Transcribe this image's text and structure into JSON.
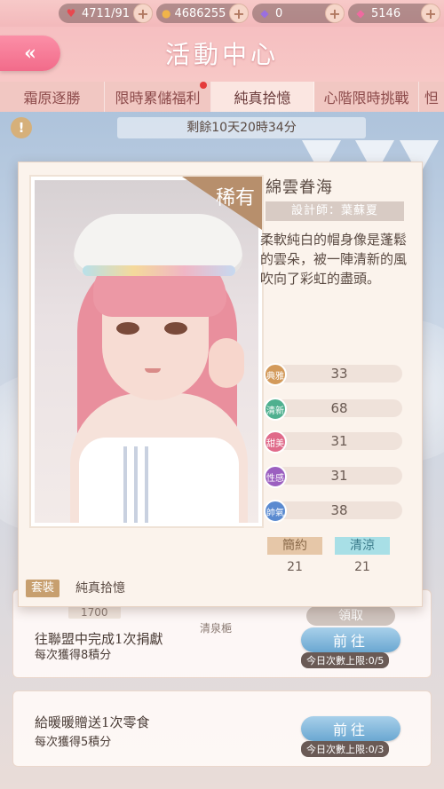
{
  "resources": [
    {
      "icon": "heart-icon",
      "value": "4711/91",
      "color": "#e8484f"
    },
    {
      "icon": "coin-icon",
      "value": "4686255",
      "color": "#f0b44a"
    },
    {
      "icon": "diamond-icon",
      "value": "0",
      "color": "#9a6fe0"
    },
    {
      "icon": "pink-diamond-icon",
      "value": "5146",
      "color": "#f06aa0"
    }
  ],
  "header": {
    "back": "«",
    "title": "活動中心"
  },
  "tabs": [
    {
      "label": "霜原逐勝",
      "active": false,
      "dot": false
    },
    {
      "label": "限時累儲福利",
      "active": false,
      "dot": true
    },
    {
      "label": "純真拾憶",
      "active": true,
      "dot": false
    },
    {
      "label": "心階限時挑戰",
      "active": false,
      "dot": false
    },
    {
      "label": "怛",
      "active": false,
      "dot": false
    }
  ],
  "countdown": {
    "icon": "!",
    "text": "剩餘10天20時34分"
  },
  "background_rows": {
    "price": "1700",
    "claim": "領取",
    "partial_name": "清泉梔"
  },
  "tasks": [
    {
      "name": "往聯盟中完成1次捐獻",
      "sub": "每次獲得8積分",
      "button": "前往",
      "limit": "今日次數上限:0/5"
    },
    {
      "name": "給暖暖贈送1次零食",
      "sub": "每次獲得5積分",
      "button": "前往",
      "limit": "今日次數上限:0/3"
    }
  ],
  "card": {
    "rarity": "稀有",
    "name": "綿雲眷海",
    "designer": "設計師：葉蘇夏",
    "description": "柔軟純白的帽身像是蓬鬆的雲朵，被一陣清新的風吹向了彩虹的盡頭。",
    "attributes": [
      {
        "label": "典雅",
        "value": "33",
        "color": "#d39a5b"
      },
      {
        "label": "清新",
        "value": "68",
        "color": "#4fb08f"
      },
      {
        "label": "甜美",
        "value": "31",
        "color": "#e06a8a"
      },
      {
        "label": "性感",
        "value": "31",
        "color": "#9b5fc0"
      },
      {
        "label": "帥氣",
        "value": "38",
        "color": "#5a8ad0"
      }
    ],
    "tags": [
      {
        "label": "簡約",
        "value": "21",
        "color": "#e6c7a8"
      },
      {
        "label": "清涼",
        "value": "21",
        "color": "#a8dfe6"
      }
    ],
    "suit_label": "套裝",
    "suit_name": "純真拾憶"
  }
}
